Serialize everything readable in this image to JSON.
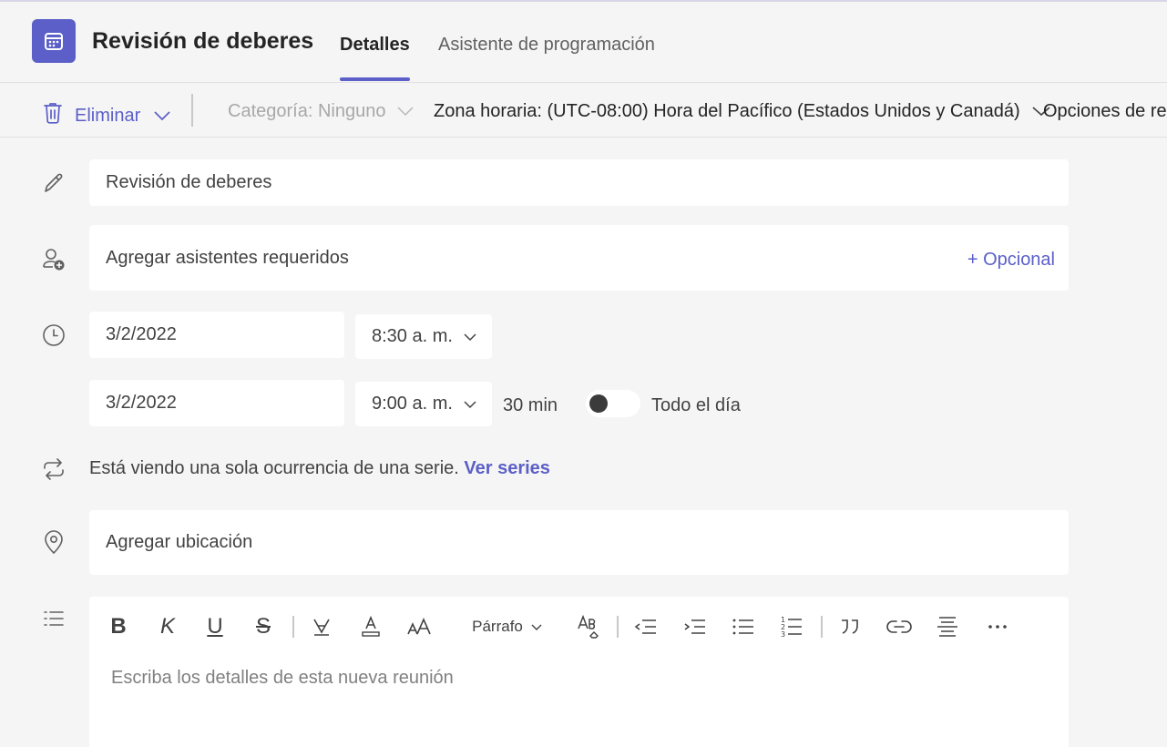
{
  "header": {
    "app_icon": "calendar-icon",
    "title": "Revisión de deberes",
    "tabs": [
      {
        "label": "Detalles",
        "active": true
      },
      {
        "label": "Asistente de programación",
        "active": false
      }
    ]
  },
  "toolbar": {
    "delete_label": "Eliminar",
    "category_label": "Categoría: Ninguno",
    "timezone_label": "Zona horaria: (UTC-08:00) Hora del Pacífico (Estados Unidos y Canadá)",
    "options_label": "Opciones de re"
  },
  "form": {
    "title_value": "Revisión de deberes",
    "attendees_placeholder": "Agregar asistentes requeridos",
    "optional_label": "+ Opcional",
    "start_date": "3/2/2022",
    "start_time": "8:30 a. m.",
    "end_date": "3/2/2022",
    "end_time": "9:00 a. m.",
    "duration": "30 min",
    "all_day_label": "Todo el día",
    "all_day_on": false,
    "series_text": "Está viendo una sola ocurrencia de una serie.",
    "series_link": "Ver series",
    "location_placeholder": "Agregar ubicación"
  },
  "editor": {
    "paragraph_label": "Párrafo",
    "placeholder": "Escriba los detalles de esta nueva reunión"
  },
  "colors": {
    "accent": "#5b5fc7",
    "background": "#f5f5f5",
    "field": "#ffffff",
    "muted_text": "#a8a8a8"
  }
}
